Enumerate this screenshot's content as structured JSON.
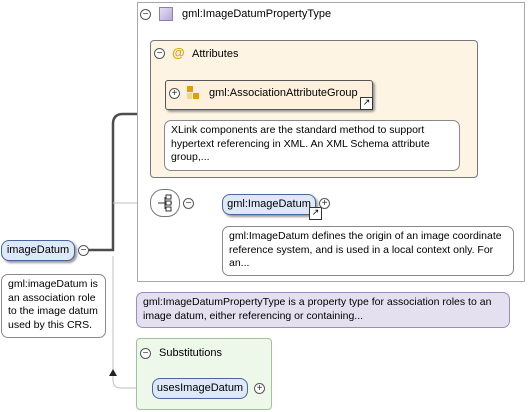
{
  "type_box": {
    "title": "gml:ImageDatumPropertyType"
  },
  "attributes": {
    "title": "Attributes",
    "group_name": "gml:AssociationAttributeGroup",
    "group_note": "XLink components are the standard method to support hypertext referencing in XML. An XML Schema attribute group,..."
  },
  "sequence": {
    "element_name": "gml:ImageDatum",
    "element_note": "gml:ImageDatum defines the origin of an image coordinate reference system, and is used in a local context only. For an..."
  },
  "type_note": "gml:ImageDatumPropertyType is a property type for association roles to an image datum, either referencing or containing...",
  "root": {
    "name": "imageDatum",
    "note": "gml:imageDatum is an association role to the image datum used by this CRS."
  },
  "substitutions": {
    "title": "Substitutions",
    "item": "usesImageDatum"
  },
  "icons": {
    "collapse": "minus-circle-icon",
    "expand": "plus-circle-icon",
    "attribute": "at-sign-icon",
    "group": "attribute-group-icon",
    "sequence": "sequence-icon",
    "reference": "arrow-link-icon"
  },
  "colors": {
    "type_box_border": "#a8a8a8",
    "attributes_fill": "#fdf4e4",
    "attributes_border": "#777777",
    "element_fill": "#dde8f8",
    "element_border": "#4a66a0",
    "type_note_fill": "#e4e0f0",
    "substitutions_fill": "#eef8ea",
    "substitutions_border": "#9ec29a"
  }
}
